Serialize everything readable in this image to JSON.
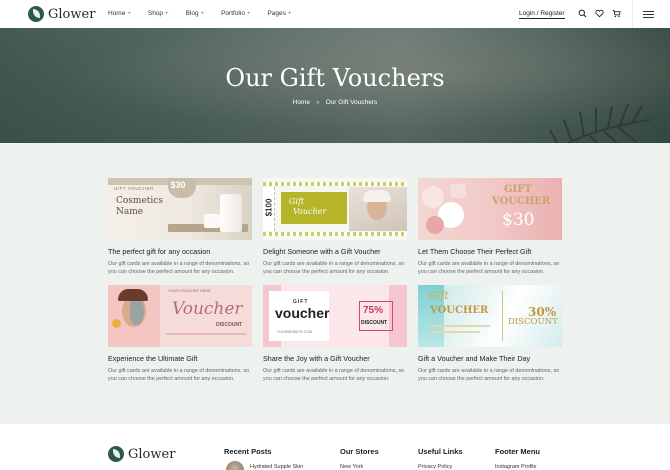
{
  "brand": {
    "name": "Glower"
  },
  "nav": [
    {
      "label": "Home"
    },
    {
      "label": "Shop"
    },
    {
      "label": "Blog"
    },
    {
      "label": "Portfolio"
    },
    {
      "label": "Pages"
    }
  ],
  "nav_plus": "+",
  "header": {
    "login": "Login / Register"
  },
  "icons": {
    "search": "search-icon",
    "wishlist": "heart-icon",
    "cart": "cart-icon",
    "menu": "hamburger-icon"
  },
  "hero": {
    "title": "Our Gift Vouchers",
    "crumb_home": "Home",
    "crumb_sep": "»",
    "crumb_current": "Our Gift Vouchers"
  },
  "colors": {
    "brand_green": "#2f5a47",
    "section_bg": "#edf2ee",
    "hero_tint": "#4f655d"
  },
  "vouchers": [
    {
      "title": "The perfect gift for any occasion",
      "desc": "Our gift cards are available in a range of denominations, so you can choose the perfect amount for any occasion.",
      "art": {
        "tag": "GIFT VOUCHER",
        "name1": "Cosmetics",
        "name2": "Name",
        "amount": "$30"
      }
    },
    {
      "title": "Delight Someone with a Gift Voucher",
      "desc": "Our gift cards are available in a range of denominations, so you can choose the perfect amount for any occasion.",
      "art": {
        "amount": "$100",
        "word1": "Gift",
        "word2": "Voucher"
      }
    },
    {
      "title": "Let Them Choose Their Perfect Gift",
      "desc": "Our gift cards are available in a range of denominations, so you can choose the perfect amount for any occasion.",
      "art": {
        "word1": "GIFT",
        "word2": "VOUCHER",
        "amount": "$30"
      }
    },
    {
      "title": "Experience the Ultimate Gift",
      "desc": "Our gift cards are available in a range of denominations, so you can choose the perfect amount for any occasion.",
      "art": {
        "tag": "YOUR VOUCHER HERE",
        "word1": "Voucher",
        "word2": "DISCOUNT"
      }
    },
    {
      "title": "Share the Joy with a Gift Voucher",
      "desc": "Our gift cards are available in a range of denominations, so you can choose the perfect amount for any occasion.",
      "art": {
        "word1": "GIFT",
        "word2": "voucher",
        "pct": "75%",
        "disc": "DISCOUNT",
        "site": "YOURWEBSITE.COM"
      }
    },
    {
      "title": "Gift a Voucher and Make Their Day",
      "desc": "Our gift cards are available in a range of denominations, so you can choose the perfect amount for any occasion.",
      "art": {
        "word1": "Gift",
        "word2": "VOUCHER",
        "pct": "30%",
        "disc": "DISCOUNT"
      }
    }
  ],
  "footer": {
    "recent_posts": "Recent Posts",
    "post1": "Hydrated Supple Skin",
    "our_stores": "Our Stores",
    "store1": "New York",
    "useful_links": "Useful Links",
    "link1": "Privacy Policy",
    "footer_menu": "Footer Menu",
    "menu1": "Instagram Profile"
  }
}
